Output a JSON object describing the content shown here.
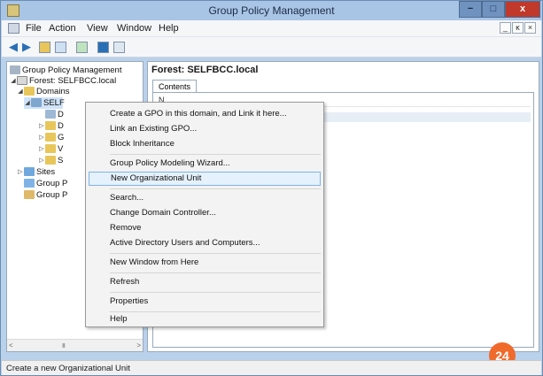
{
  "window": {
    "title": "Group Policy Management",
    "controls": {
      "minimize": "−",
      "maximize": "□",
      "close": "x"
    }
  },
  "menubar": {
    "items": [
      "File",
      "Action",
      "View",
      "Window",
      "Help"
    ],
    "mdi": {
      "minimize": "_",
      "restore": "ĸ",
      "close": "×"
    }
  },
  "toolbar": {
    "icons": [
      "back-arrow-icon",
      "forward-arrow-icon",
      "folder-up-icon",
      "show-tree-icon",
      "refresh-icon",
      "help-icon",
      "console-icon"
    ]
  },
  "tree": {
    "items": [
      {
        "label": "Group Policy Management",
        "indent": 0,
        "arrow": "",
        "icon": "gpm-icon"
      },
      {
        "label": "Forest: SELFBCC.local",
        "indent": 1,
        "arrow": "◢",
        "icon": "forest-icon"
      },
      {
        "label": "Domains",
        "indent": 2,
        "arrow": "◢",
        "icon": "domains-icon"
      },
      {
        "label": "SELF",
        "indent": 3,
        "arrow": "◢",
        "icon": "domain-icon",
        "selected": true
      },
      {
        "label": "D",
        "indent": 4,
        "arrow": "",
        "icon": "gpo-link-icon"
      },
      {
        "label": "D",
        "indent": 4,
        "arrow": "▷",
        "icon": "ou-icon"
      },
      {
        "label": "G",
        "indent": 4,
        "arrow": "▷",
        "icon": "folder-icon"
      },
      {
        "label": "V",
        "indent": 4,
        "arrow": "▷",
        "icon": "folder-icon"
      },
      {
        "label": "S",
        "indent": 4,
        "arrow": "▷",
        "icon": "folder-icon"
      },
      {
        "label": "Sites",
        "indent": 1,
        "arrow": "▷",
        "icon": "sites-icon"
      },
      {
        "label": "Group P",
        "indent": 1,
        "arrow": "",
        "icon": "modeling-icon"
      },
      {
        "label": "Group P",
        "indent": 1,
        "arrow": "",
        "icon": "results-icon"
      }
    ],
    "scroll": {
      "left": "<",
      "right": ">",
      "thumb": "III"
    }
  },
  "right_pane": {
    "title": "Forest: SELFBCC.local",
    "tab": "Contents",
    "column_header": "N"
  },
  "context_menu": {
    "items": [
      {
        "label": "Create a GPO in this domain, and Link it here...",
        "type": "item"
      },
      {
        "label": "Link an Existing GPO...",
        "type": "item"
      },
      {
        "label": "Block Inheritance",
        "type": "item"
      },
      {
        "type": "separator"
      },
      {
        "label": "Group Policy Modeling Wizard...",
        "type": "item"
      },
      {
        "label": "New Organizational Unit",
        "type": "item",
        "highlighted": true
      },
      {
        "type": "separator"
      },
      {
        "label": "Search...",
        "type": "item"
      },
      {
        "label": "Change Domain Controller...",
        "type": "item"
      },
      {
        "label": "Remove",
        "type": "item"
      },
      {
        "label": "Active Directory Users and Computers...",
        "type": "item"
      },
      {
        "type": "separator"
      },
      {
        "label": "New Window from Here",
        "type": "item"
      },
      {
        "type": "separator"
      },
      {
        "label": "Refresh",
        "type": "item"
      },
      {
        "type": "separator"
      },
      {
        "label": "Properties",
        "type": "item"
      },
      {
        "type": "separator"
      },
      {
        "label": "Help",
        "type": "item"
      }
    ]
  },
  "status_bar": {
    "text": "Create a new Organizational Unit"
  },
  "step_badge": {
    "number": "24"
  },
  "colors": {
    "title_bar": "#a9c5e6",
    "close_button": "#c0392b",
    "menu_highlight": "#e5f1fb",
    "menu_highlight_border": "#7eb4ea",
    "badge": "#f06a2c"
  }
}
